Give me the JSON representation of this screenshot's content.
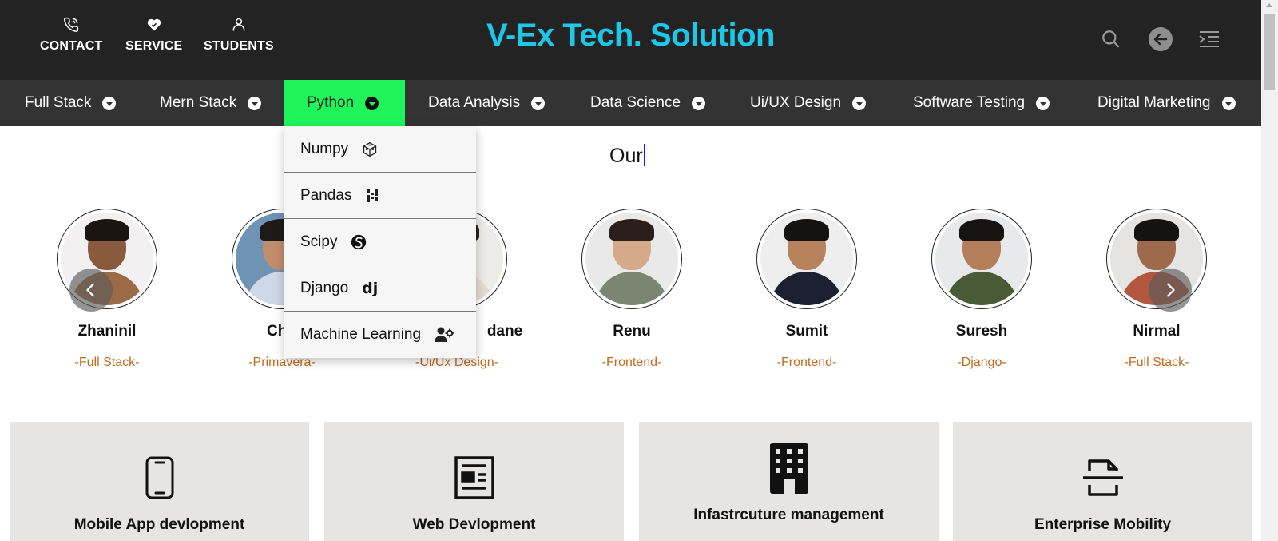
{
  "header": {
    "links": [
      {
        "label": "CONTACT",
        "icon": "phone-icon"
      },
      {
        "label": "SERVICE",
        "icon": "heart-hand-icon"
      },
      {
        "label": "STUDENTS",
        "icon": "user-icon"
      }
    ],
    "brand": "V-Ex Tech. Solution",
    "brand_color": "#1cc8ea",
    "tools": [
      "search-icon",
      "back-arrow-icon",
      "menu-indent-icon"
    ]
  },
  "nav": {
    "items": [
      {
        "label": "Full Stack",
        "active": false
      },
      {
        "label": "Mern Stack",
        "active": false
      },
      {
        "label": "Python",
        "active": true
      },
      {
        "label": "Data Analysis",
        "active": false
      },
      {
        "label": "Data Science",
        "active": false
      },
      {
        "label": "Ui/UX Design",
        "active": false
      },
      {
        "label": "Software Testing",
        "active": false
      },
      {
        "label": "Digital Marketing",
        "active": false
      }
    ],
    "active_color": "#1ff55a"
  },
  "dropdown": {
    "items": [
      {
        "label": "Numpy",
        "icon": "numpy-cube-icon"
      },
      {
        "label": "Pandas",
        "icon": "pandas-bars-icon"
      },
      {
        "label": "Scipy",
        "icon": "scipy-icon"
      },
      {
        "label": "Django",
        "icon": "django-dj-icon"
      },
      {
        "label": "Machine Learning",
        "icon": "user-gear-icon"
      }
    ]
  },
  "heading": {
    "text": "Our"
  },
  "students": [
    {
      "name": "Zhaninil",
      "course": "-Full Stack-"
    },
    {
      "name": "Chir",
      "course": "-Primavera-"
    },
    {
      "name": "dane",
      "course": "-Ui/Ux Design-"
    },
    {
      "name": "Renu",
      "course": "-Frontend-"
    },
    {
      "name": "Sumit",
      "course": "-Frontend-"
    },
    {
      "name": "Suresh",
      "course": "-Django-"
    },
    {
      "name": "Nirmal",
      "course": "-Full Stack-"
    }
  ],
  "services": [
    {
      "title": "Mobile App devlopment",
      "icon": "mobile-phone-icon"
    },
    {
      "title": "Web Devlopment",
      "icon": "web-page-icon"
    },
    {
      "title": "Infastrcuture management",
      "icon": "building-icon"
    },
    {
      "title": "Enterprise Mobility",
      "icon": "scan-document-icon"
    }
  ]
}
